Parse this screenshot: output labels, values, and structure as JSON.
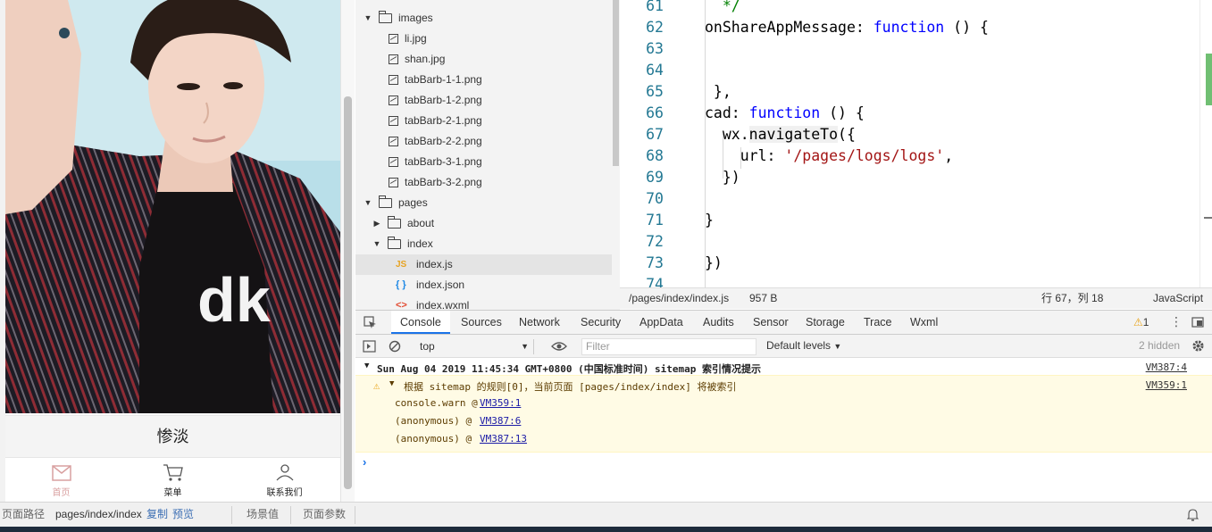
{
  "simulator": {
    "caption": "惨淡",
    "tabs": [
      {
        "label": "首页",
        "icon": "home-icon",
        "active": true
      },
      {
        "label": "菜单",
        "icon": "cart-icon",
        "active": false
      },
      {
        "label": "联系我们",
        "icon": "user-icon",
        "active": false
      }
    ]
  },
  "file_tree": [
    {
      "label": "images",
      "type": "folder",
      "expanded": true
    },
    {
      "label": "li.jpg",
      "type": "image"
    },
    {
      "label": "shan.jpg",
      "type": "image"
    },
    {
      "label": "tabBarb-1-1.png",
      "type": "image"
    },
    {
      "label": "tabBarb-1-2.png",
      "type": "image"
    },
    {
      "label": "tabBarb-2-1.png",
      "type": "image"
    },
    {
      "label": "tabBarb-2-2.png",
      "type": "image"
    },
    {
      "label": "tabBarb-3-1.png",
      "type": "image"
    },
    {
      "label": "tabBarb-3-2.png",
      "type": "image"
    },
    {
      "label": "pages",
      "type": "folder",
      "expanded": true
    },
    {
      "label": "about",
      "type": "folder",
      "expanded": false
    },
    {
      "label": "index",
      "type": "folder",
      "expanded": true
    },
    {
      "label": "index.js",
      "type": "js",
      "selected": true
    },
    {
      "label": "index.json",
      "type": "json"
    },
    {
      "label": "index.wxml",
      "type": "wxml"
    }
  ],
  "editor": {
    "lines": [
      {
        "num": "61",
        "text": "  */"
      },
      {
        "num": "62",
        "text": "onShareAppMessage: function () {"
      },
      {
        "num": "63",
        "text": ""
      },
      {
        "num": "64",
        "text": ""
      },
      {
        "num": "65",
        "text": " },"
      },
      {
        "num": "66",
        "text": "cad: function () {"
      },
      {
        "num": "67",
        "text": "  wx.navigateTo({"
      },
      {
        "num": "68",
        "text": "    url: '/pages/logs/logs',"
      },
      {
        "num": "69",
        "text": "  })"
      },
      {
        "num": "70",
        "text": ""
      },
      {
        "num": "71",
        "text": "}"
      },
      {
        "num": "72",
        "text": ""
      },
      {
        "num": "73",
        "text": "})"
      },
      {
        "num": "74",
        "text": ""
      }
    ],
    "status": {
      "path": "/pages/index/index.js",
      "size": "957 B",
      "position": "行 67，列 18",
      "language": "JavaScript"
    }
  },
  "devtools": {
    "tabs": [
      "Console",
      "Sources",
      "Network",
      "Security",
      "AppData",
      "Audits",
      "Sensor",
      "Storage",
      "Trace",
      "Wxml"
    ],
    "active_tab": "Console",
    "warning_count": "1",
    "context": "top",
    "filter_placeholder": "Filter",
    "levels": "Default levels",
    "hidden": "2 hidden",
    "messages": {
      "group_header": "Sun Aug 04 2019 11:45:34 GMT+0800 (中国标准时间) sitemap 索引情况提示",
      "group_source": "VM387:4",
      "warning_text": "根据 sitemap 的规则[0]，当前页面 [pages/index/index] 将被索引",
      "warning_source": "VM359:1",
      "trace": [
        {
          "fn": "console.warn @ ",
          "link": "VM359:1"
        },
        {
          "fn": "(anonymous)  @ ",
          "link": "VM387:6"
        },
        {
          "fn": "(anonymous)  @ ",
          "link": "VM387:13"
        }
      ]
    }
  },
  "bottom_bar": {
    "path_label": "页面路径",
    "path_value": "pages/index/index",
    "copy": "复制",
    "preview": "预览",
    "scene": "场景值",
    "params": "页面参数"
  },
  "colors": {
    "accent": "#1a73e8",
    "warning_bg": "#fffbe5",
    "keyword": "#0000ff",
    "string": "#a31515",
    "line_number": "#237893"
  }
}
